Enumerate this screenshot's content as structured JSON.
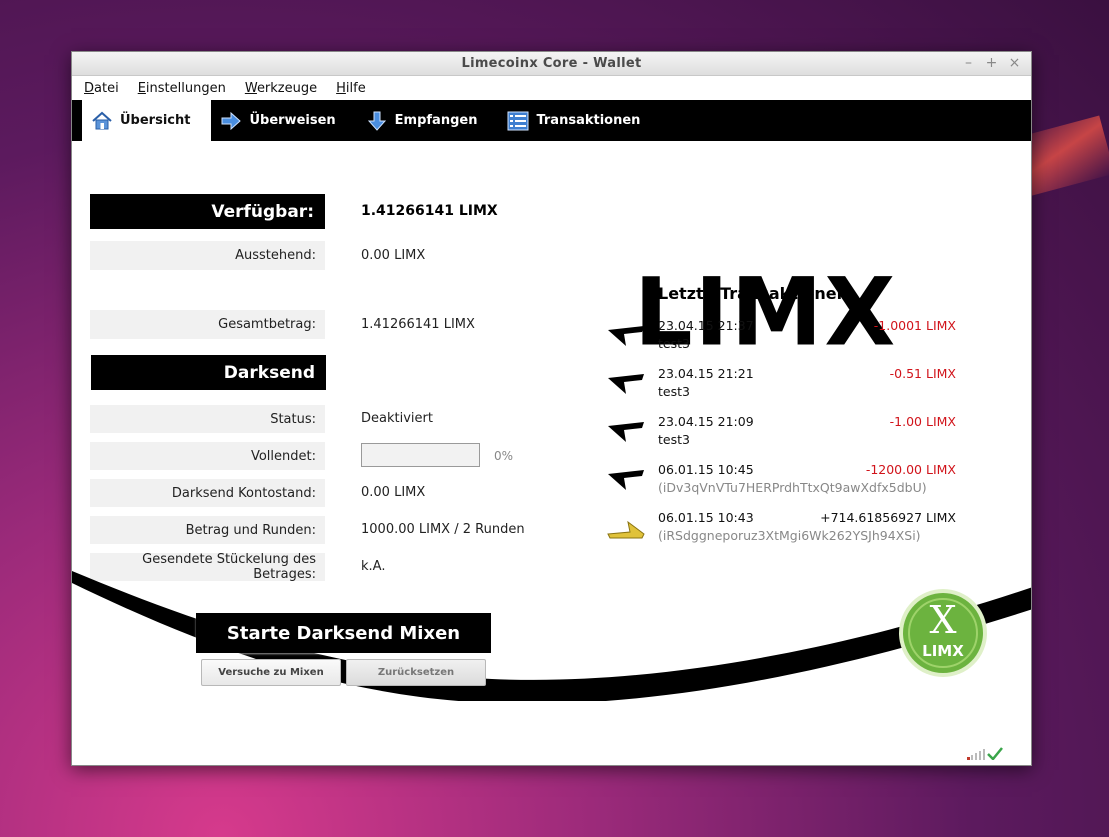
{
  "window": {
    "title": "Limecoinx Core - Wallet"
  },
  "menu": [
    "Datei",
    "Einstellungen",
    "Werkzeuge",
    "Hilfe"
  ],
  "tabs": [
    {
      "label": "Übersicht",
      "icon": "home-icon"
    },
    {
      "label": "Überweisen",
      "icon": "send-arrow-icon"
    },
    {
      "label": "Empfangen",
      "icon": "receive-arrow-icon"
    },
    {
      "label": "Transaktionen",
      "icon": "list-icon"
    }
  ],
  "balance": {
    "available_label": "Verfügbar:",
    "available_value": "1.41266141 LIMX",
    "pending_label": "Ausstehend:",
    "pending_value": "0.00 LIMX",
    "total_label": "Gesamtbetrag:",
    "total_value": "1.41266141 LIMX"
  },
  "darksend": {
    "heading": "Darksend",
    "status_label": "Status:",
    "status_value": "Deaktiviert",
    "completed_label": "Vollendet:",
    "completed_percent": "0%",
    "completed_fraction": 0,
    "balance_label": "Darksend Kontostand:",
    "balance_value": "0.00 LIMX",
    "amount_rounds_label": "Betrag und Runden:",
    "amount_rounds_value": "1000.00 LIMX / 2 Runden",
    "denom_label": "Gesendete Stückelung des Betrages:",
    "denom_value": "k.A.",
    "start_button": "Starte Darksend Mixen",
    "try_button": "Versuche zu Mixen",
    "reset_button": "Zurücksetzen"
  },
  "logo_text": "LIMX",
  "coin_text": {
    "x": "X",
    "name": "LIMX"
  },
  "recent": {
    "title": "Letzte Transaktionen",
    "items": [
      {
        "date": "23.04.15 21:37",
        "amount": "-1.0001 LIMX",
        "label": "test3",
        "kind": "sent"
      },
      {
        "date": "23.04.15 21:21",
        "amount": "-0.51 LIMX",
        "label": "test3",
        "kind": "sent"
      },
      {
        "date": "23.04.15 21:09",
        "amount": "-1.00 LIMX",
        "label": "test3",
        "kind": "sent"
      },
      {
        "date": "06.01.15 10:45",
        "amount": "-1200.00 LIMX",
        "label": "(iDv3qVnVTu7HERPrdhTtxQt9awXdfx5dbU)",
        "kind": "sent"
      },
      {
        "date": "06.01.15 10:43",
        "amount": "+714.61856927 LIMX",
        "label": "(iRSdggneporuz3XtMgi6Wk262YSJh94XSi)",
        "kind": "received"
      }
    ]
  },
  "colors": {
    "negative": "#d1141b",
    "accent": "#000000",
    "coin_green": "#6cb33f"
  }
}
